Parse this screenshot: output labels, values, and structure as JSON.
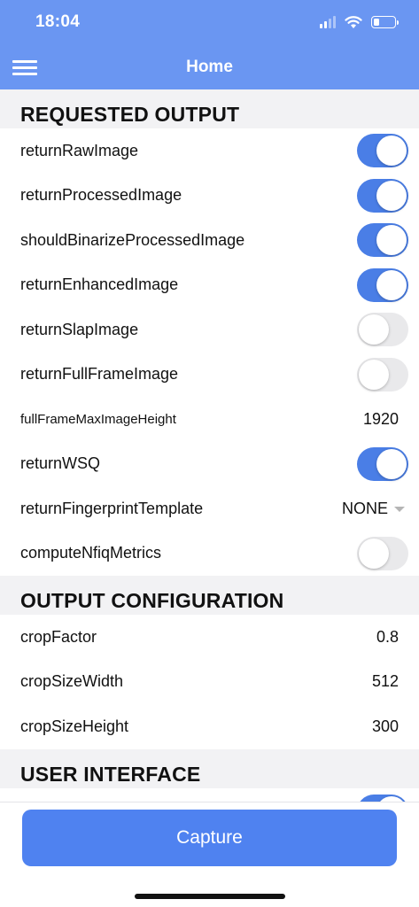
{
  "status_bar": {
    "time": "18:04"
  },
  "nav": {
    "title": "Home"
  },
  "sections": {
    "requested_output": {
      "title": "REQUESTED OUTPUT",
      "rows": [
        {
          "label": "returnRawImage",
          "kind": "toggle",
          "on": true
        },
        {
          "label": "returnProcessedImage",
          "kind": "toggle",
          "on": true
        },
        {
          "label": "shouldBinarizeProcessedImage",
          "kind": "toggle",
          "on": true
        },
        {
          "label": "returnEnhancedImage",
          "kind": "toggle",
          "on": true
        },
        {
          "label": "returnSlapImage",
          "kind": "toggle",
          "on": false
        },
        {
          "label": "returnFullFrameImage",
          "kind": "toggle",
          "on": false
        },
        {
          "label": "fullFrameMaxImageHeight",
          "kind": "value",
          "value": "1920"
        },
        {
          "label": "returnWSQ",
          "kind": "toggle",
          "on": true
        },
        {
          "label": "returnFingerprintTemplate",
          "kind": "dropdown",
          "value": "NONE"
        },
        {
          "label": "computeNfiqMetrics",
          "kind": "toggle",
          "on": false
        }
      ]
    },
    "output_configuration": {
      "title": "OUTPUT CONFIGURATION",
      "rows": [
        {
          "label": "cropFactor",
          "kind": "value",
          "value": "0.8"
        },
        {
          "label": "cropSizeWidth",
          "kind": "value",
          "value": "512"
        },
        {
          "label": "cropSizeHeight",
          "kind": "value",
          "value": "300"
        }
      ]
    },
    "user_interface": {
      "title": "USER INTERFACE",
      "first_toggle_on": true
    }
  },
  "footer": {
    "capture_label": "Capture"
  },
  "colors": {
    "header_bg": "#6a96f2",
    "toggle_on": "#4a7ee6",
    "toggle_off": "#e9e9eb",
    "button_bg": "#4f82f0",
    "section_bg": "#f2f2f4"
  }
}
